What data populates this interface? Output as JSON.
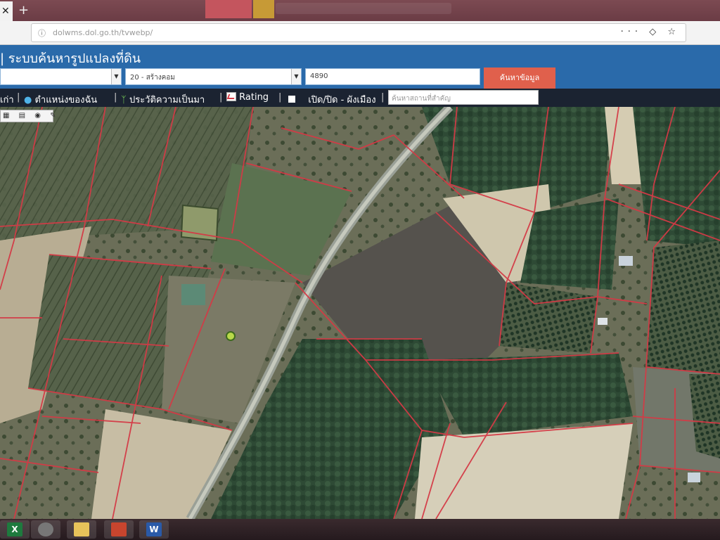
{
  "browser": {
    "tab_close": "✕",
    "new_tab": "+",
    "url": "dolwms.dol.go.th/tvwebp/",
    "url_actions": "··· ◇ ☆"
  },
  "app": {
    "title": "| ระบบค้นหารูปแปลงที่ดิน",
    "province_value": "",
    "district_value": "20 - สร้างคอม",
    "parcel_value": "4890",
    "search_button": "ค้นหาข้อมูล"
  },
  "menu": {
    "home": "เก่า",
    "my_location": "ตำแหน่งของฉัน",
    "history": "ประวัติความเป็นมา",
    "rating": "Rating",
    "toggle_layer": "เปิด/ปิด - ผังเมือง",
    "place_placeholder": "ค้นหาสถานที่สำคัญ",
    "separator": "|"
  },
  "map_toolbar": "▦ ▤ ◉ ✎",
  "taskbar": {
    "apps": [
      "excel-icon",
      "browser-icon",
      "explorer-icon",
      "powerpoint-icon",
      "word-icon"
    ],
    "word_letter": "W",
    "excel_letter": "X"
  },
  "colors": {
    "header_blue": "#2a6aaa",
    "menu_dark": "#1b2331",
    "search_button": "#e0604c",
    "parcel_line": "#d43a46"
  }
}
